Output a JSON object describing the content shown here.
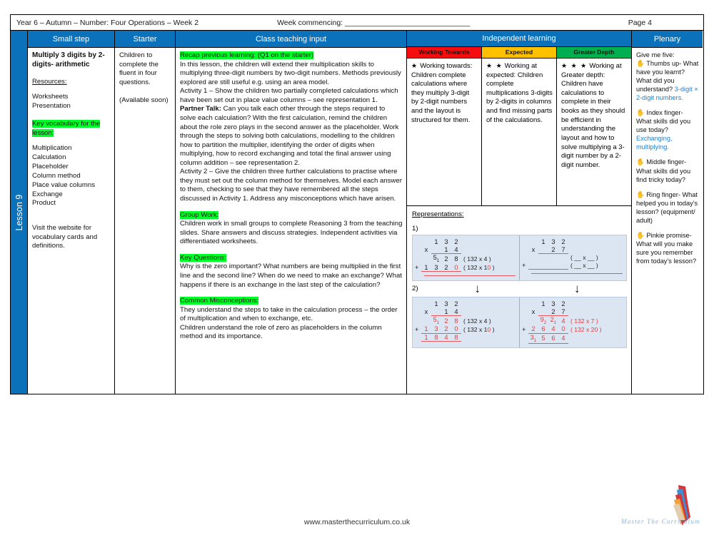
{
  "header": {
    "left": "Year 6 – Autumn – Number: Four Operations – Week 2",
    "week_commencing_label": "Week commencing: ______________________________",
    "page": "Page 4"
  },
  "spine": {
    "label": "Lesson 9"
  },
  "columns": {
    "small_step": "Small step",
    "starter": "Starter",
    "teaching": "Class teaching input",
    "independent": "Independent learning",
    "plenary": "Plenary"
  },
  "small_step": {
    "title": "Multiply 3 digits by 2-digits- arithmetic",
    "resources_label": "Resources:",
    "resources": [
      "Worksheets",
      "Presentation"
    ],
    "vocab_label": "Key vocabulary for the lesson:",
    "vocab": [
      "Multiplication",
      "Calculation",
      "Placeholder",
      "Column method",
      "Place value columns",
      "Exchange",
      "Product"
    ],
    "footnote": "Visit the website for vocabulary cards and definitions."
  },
  "starter": {
    "text": "Children to complete the fluent in four questions.",
    "note": "(Available soon)"
  },
  "teaching": {
    "recap_label": "Recap previous learning: (Q1 on the starter)",
    "recap_body_1": "In this lesson, the children will extend their multiplication skills to multiplying three-digit numbers by two-digit numbers. Methods previously explored are still useful e.g. using an area model.",
    "activity1_a": "Activity 1 – Show the children two partially completed calculations which have been set out in place value columns – see representation 1.",
    "partner_talk_label": "Partner Talk:",
    "activity1_b": "Can you talk each other through the steps required to solve each calculation? With the first calculation, remind the children about the role zero plays in the second answer as the placeholder. Work through the steps to solving both calculations, modelling to the children how to partition the multiplier, identifying the order of digits when multiplying, how to record exchanging and total the final answer using column addition – see representation 2.",
    "activity2": "Activity 2 – Give the children three further calculations to practise where they must set out the column method for themselves. Model each answer to them, checking to see that they have remembered all the steps discussed in Activity 1. Address any misconceptions which have arisen.",
    "group_work_label": "Group Work:",
    "group_work_body": "Children work in small groups to complete Reasoning 3 from the teaching slides. Share answers and discuss strategies. Independent activities via differentiated worksheets.",
    "key_questions_label": "Key Questions:",
    "key_questions_body": "Why is the zero important? What numbers are being multiplied in the first line and the second line? When do we need to make an exchange? What happens if there is an exchange in the last step of the calculation?",
    "misconceptions_label": "Common Misconceptions:",
    "misconceptions_body_1": "They understand the steps to take in the calculation process – the order of multiplication and when to exchange, etc.",
    "misconceptions_body_2": "Children understand the role of  zero as placeholders in the column method and its importance."
  },
  "independent": {
    "tiers": [
      {
        "name": "Working Towards",
        "color": "#f60d0d",
        "stars": "★",
        "lead": "Working towards:",
        "body": "Children complete calculations where they multiply 3-digit by 2-digit numbers and the layout is structured for them."
      },
      {
        "name": "Expected",
        "color": "#ffc000",
        "stars": "★ ★",
        "lead": "Working at expected:",
        "body": "Children complete multiplications 3-digits by 2-digits in columns and find missing parts of the calculations."
      },
      {
        "name": "Greater Depth",
        "color": "#00b050",
        "stars": "★ ★ ★",
        "lead": "Working at Greater depth:",
        "body": "Children have calculations to complete in their books as they should be efficient in understanding the layout and how to solve multiplying a 3-digit number by a 2-digit number."
      }
    ],
    "representations_label": "Representations:",
    "step_labels": [
      "1)",
      "2)"
    ],
    "arrow": "↓",
    "calcs": {
      "rep1_left": {
        "multiplicand": [
          "1",
          "3",
          "2"
        ],
        "multiplier": [
          "1",
          "4"
        ],
        "times_symbol": "x",
        "plus_symbol": "+",
        "partial1": {
          "digits": [
            "",
            "5",
            "2",
            "8"
          ],
          "carries": [
            "",
            "1",
            "",
            ""
          ],
          "annotation": "( 132 x 4 )"
        },
        "partial2": {
          "digits": [
            "1",
            "3",
            "2",
            "0"
          ],
          "red_index": 3,
          "annotation": "( 132 x 10 )",
          "annotation_red_char": "0"
        },
        "total": {
          "digits": [
            "",
            "",
            "",
            ""
          ]
        }
      },
      "rep1_right": {
        "multiplicand": [
          "1",
          "3",
          "2"
        ],
        "multiplier": [
          "2",
          "7"
        ],
        "times_symbol": "x",
        "plus_symbol": "+",
        "partial1": {
          "digits": [
            "",
            "",
            "",
            ""
          ],
          "annotation": "( __ x __ )"
        },
        "partial2": {
          "digits": [
            "",
            "",
            "",
            ""
          ],
          "annotation": "( __ x __ )"
        },
        "total": {
          "digits": [
            "",
            "",
            "",
            ""
          ]
        }
      },
      "rep2_left": {
        "multiplicand": [
          "1",
          "3",
          "2"
        ],
        "multiplier": [
          "1",
          "4"
        ],
        "times_symbol": "x",
        "plus_symbol": "+",
        "partial1": {
          "digits": [
            "",
            "5",
            "2",
            "8"
          ],
          "carries": [
            "",
            "1",
            "",
            ""
          ],
          "annotation": "( 132 x 4 )"
        },
        "partial2": {
          "digits": [
            "1",
            "3",
            "2",
            "0"
          ],
          "annotation": "( 132 x 10 )"
        },
        "total": {
          "digits": [
            "1",
            "8",
            "4",
            "8"
          ]
        }
      },
      "rep2_right": {
        "multiplicand": [
          "1",
          "3",
          "2"
        ],
        "multiplier": [
          "2",
          "7"
        ],
        "times_symbol": "x",
        "plus_symbol": "+",
        "partial1": {
          "digits": [
            "",
            "9",
            "2",
            "4"
          ],
          "carries": [
            "",
            "2",
            "1",
            ""
          ],
          "annotation": "( 132 x 7 )"
        },
        "partial2": {
          "digits": [
            "2",
            "6",
            "4",
            "0"
          ],
          "annotation": "( 132 x 20 )"
        },
        "total": {
          "digits": [
            "3",
            "5",
            "6",
            "4"
          ],
          "carries": [
            "1",
            "",
            "",
            ""
          ]
        }
      }
    }
  },
  "plenary": {
    "title": "Give me five:",
    "items": [
      {
        "icon": "hand-icon",
        "prompt": "Thumbs up- What have you learnt? What did you understand?",
        "answer": "3-digit × 2-digit numbers."
      },
      {
        "icon": "hand-icon",
        "prompt": "Index finger- What skills did you use today?",
        "answer": "Exchanging, multiplying."
      },
      {
        "icon": "hand-icon",
        "prompt": "Middle finger- What skills did you find tricky today?",
        "answer": ""
      },
      {
        "icon": "hand-icon",
        "prompt": "Ring finger- What helped you in today’s lesson? (equipment/ adult)",
        "answer": ""
      },
      {
        "icon": "hand-icon",
        "prompt": "Pinkie promise- What will you make sure you remember from today’s lesson?",
        "answer": ""
      }
    ]
  },
  "footer": {
    "url": "www.masterthecurriculum.co.uk",
    "logo_text": "Master  The  Curriculum"
  },
  "theme": {
    "header_blue": "#0a71ba",
    "highlight_green": "#00ff2a",
    "calc_bg": "#dce6f2",
    "rule_red": "#e8575c",
    "answer_red": "#e03c3c",
    "plenary_blue": "#1f7fd0"
  }
}
